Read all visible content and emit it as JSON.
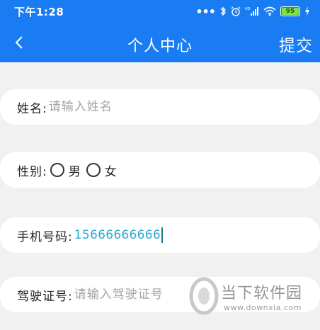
{
  "status_bar": {
    "time": "下午1:28",
    "dots": "•••",
    "icons": [
      "bluetooth-icon",
      "alarm-icon",
      "hd-signal-icon",
      "wifi-icon",
      "battery-icon",
      "charging-icon"
    ],
    "battery_level": "95",
    "hd_label": "HD"
  },
  "header": {
    "title": "个人中心",
    "submit_label": "提交",
    "back_icon": "chevron-left-icon",
    "background_color": "#1a7cf2"
  },
  "form": {
    "name": {
      "label": "姓名:",
      "placeholder": "请输入姓名",
      "value": ""
    },
    "gender": {
      "label": "性别:",
      "options": [
        "男",
        "女"
      ],
      "selected": null
    },
    "phone": {
      "label": "手机号码:",
      "value": "15666666666",
      "value_color": "#2aa9d6"
    },
    "license": {
      "label": "驾驶证号:",
      "placeholder": "请输入驾驶证号",
      "value": ""
    }
  },
  "watermark": {
    "text": "当下软件园",
    "url": "www.downxia.com"
  }
}
